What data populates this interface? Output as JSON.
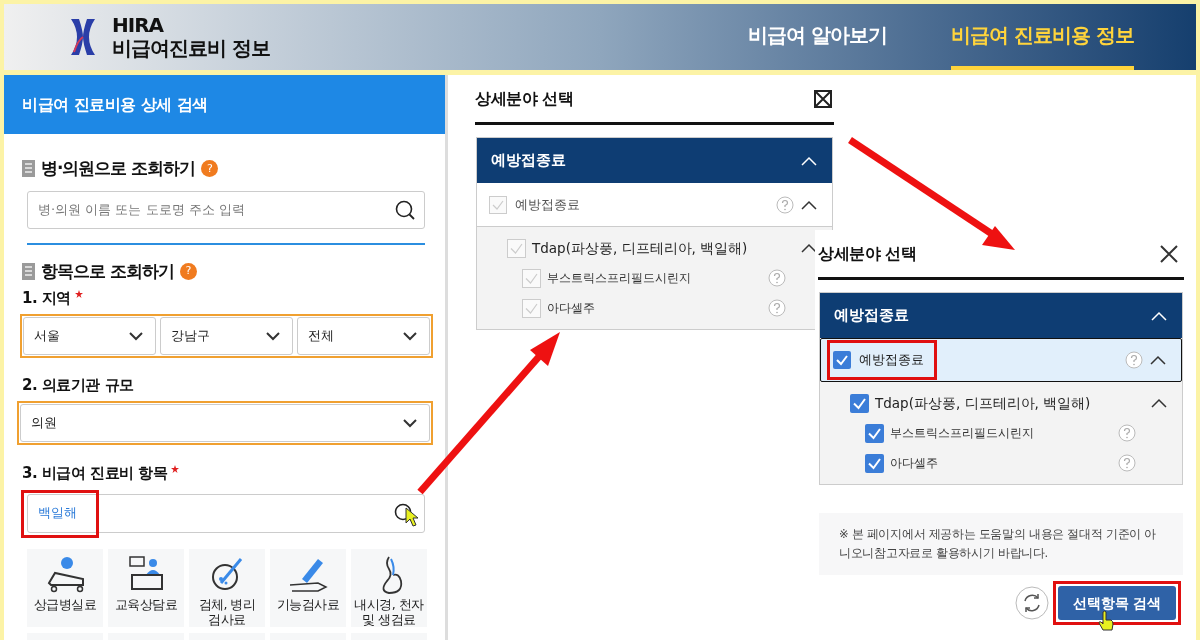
{
  "header": {
    "logo_line1": "HIRA",
    "logo_line2": "비급여진료비 정보",
    "nav": [
      {
        "label": "비급여 알아보기",
        "selected": false
      },
      {
        "label": "비급여 진료비용 정보",
        "selected": true
      }
    ]
  },
  "search_panel": {
    "title": "비급여 진료비용 상세 검색",
    "by_hospital": {
      "heading": "병·의원으로 조회하기",
      "help": "?",
      "placeholder": "병·의원 이름 또는 도로명 주소 입력"
    },
    "by_item": {
      "heading": "항목으로 조회하기",
      "help": "?",
      "region": {
        "label": "1. 지역",
        "required": true,
        "highlight": {
          "color": "#f0a030"
        },
        "selects": [
          "서울",
          "강남구",
          "전체"
        ]
      },
      "scale": {
        "label": "2. 의료기관 규모",
        "required": false,
        "highlight": {
          "color": "#f0a030"
        },
        "select": "의원"
      },
      "item": {
        "label": "3. 비급여 진료비 항목",
        "required": true,
        "chip": "백일해",
        "highlight": {
          "color": "#e01010"
        }
      },
      "categories": [
        "상급병실료",
        "교육상담료",
        "검체, 병리 검사료",
        "기능검사료",
        "내시경, 천자 및 생검료"
      ]
    }
  },
  "dialogs": [
    {
      "kind": "boxed",
      "title": "상세분야 선택",
      "group": "예방접종료",
      "tree": [
        {
          "label": "예방접종료",
          "checked": false,
          "selected": false,
          "help": true,
          "expanded": true,
          "children": [
            {
              "label": "Tdap(파상풍, 디프테리아, 백일해)",
              "checked": false,
              "help": false,
              "expanded": true,
              "children": [
                {
                  "label": "부스트릭스프리필드시린지",
                  "checked": false,
                  "help": true
                },
                {
                  "label": "아다셀주",
                  "checked": false,
                  "help": true
                }
              ]
            }
          ]
        }
      ]
    },
    {
      "kind": "plain",
      "title": "상세분야 선택",
      "group": "예방접종료",
      "tree": [
        {
          "label": "예방접종료",
          "checked": true,
          "selected": true,
          "help": true,
          "expanded": true,
          "highlight": {
            "color": "#e01010"
          },
          "children": [
            {
              "label": "Tdap(파상풍, 디프테리아, 백일해)",
              "checked": true,
              "help": false,
              "expanded": true,
              "children": [
                {
                  "label": "부스트릭스프리필드시린지",
                  "checked": true,
                  "help": true
                },
                {
                  "label": "아다셀주",
                  "checked": true,
                  "help": true
                }
              ]
            }
          ]
        }
      ],
      "note": "※ 본 페이지에서 제공하는 도움말의 내용은 절대적 기준이 아니오니참고자료로 활용하시기 바랍니다.",
      "search_button": "선택항목 검색",
      "search_button_highlight": {
        "color": "#e01010"
      }
    }
  ]
}
